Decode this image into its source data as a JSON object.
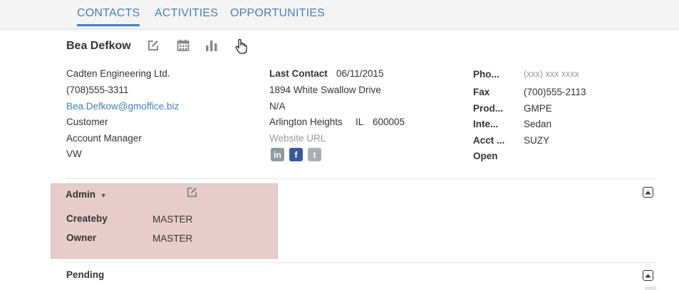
{
  "tabs": [
    "CONTACTS",
    "ACTIVITIES",
    "OPPORTUNITIES"
  ],
  "contact": {
    "name": "Bea Defkow",
    "company": "Cadten Engineering Ltd.",
    "phone": "(708)555-3311",
    "email": "Bea.Defkow@gmoffice.biz",
    "type": "Customer",
    "title": "Account Manager",
    "code": "VW"
  },
  "middle": {
    "last_contact_label": "Last Contact",
    "last_contact_value": "06/11/2015",
    "address": "1894 White Swallow Drive",
    "address2": "N/A",
    "city": "Arlington Heights",
    "state": "IL",
    "zip": "600005",
    "website_placeholder": "Website URL"
  },
  "right": {
    "rows": [
      {
        "label": "Pho...",
        "value": "(xxx) xxx xxxx"
      },
      {
        "label": "Fax",
        "value": "(700)555-2113"
      },
      {
        "label": "Prod...",
        "value": "GMPE"
      },
      {
        "label": "Inte...",
        "value": "Sedan"
      },
      {
        "label": "Acct ...",
        "value": "SUZY"
      },
      {
        "label": "Open",
        "value": ""
      }
    ]
  },
  "admin": {
    "title": "Admin",
    "rows": [
      {
        "label": "Createby",
        "value": "MASTER"
      },
      {
        "label": "Owner",
        "value": "MASTER"
      }
    ]
  },
  "pending": {
    "title": "Pending"
  },
  "icons": {
    "edit": "edit-icon",
    "calendar": "calendar-icon",
    "chart": "bar-chart-icon",
    "cursor": "hand-cursor-icon",
    "linkedin": "linkedin-icon",
    "facebook": "facebook-icon",
    "twitter": "twitter-icon",
    "collapse": "collapse-up-icon"
  },
  "colors": {
    "accent": "#4a7fb4",
    "admin_highlight": "#e8cccc",
    "linkedin": "#8e9aa6",
    "facebook": "#3b5998",
    "twitter": "#a8aeb4"
  }
}
